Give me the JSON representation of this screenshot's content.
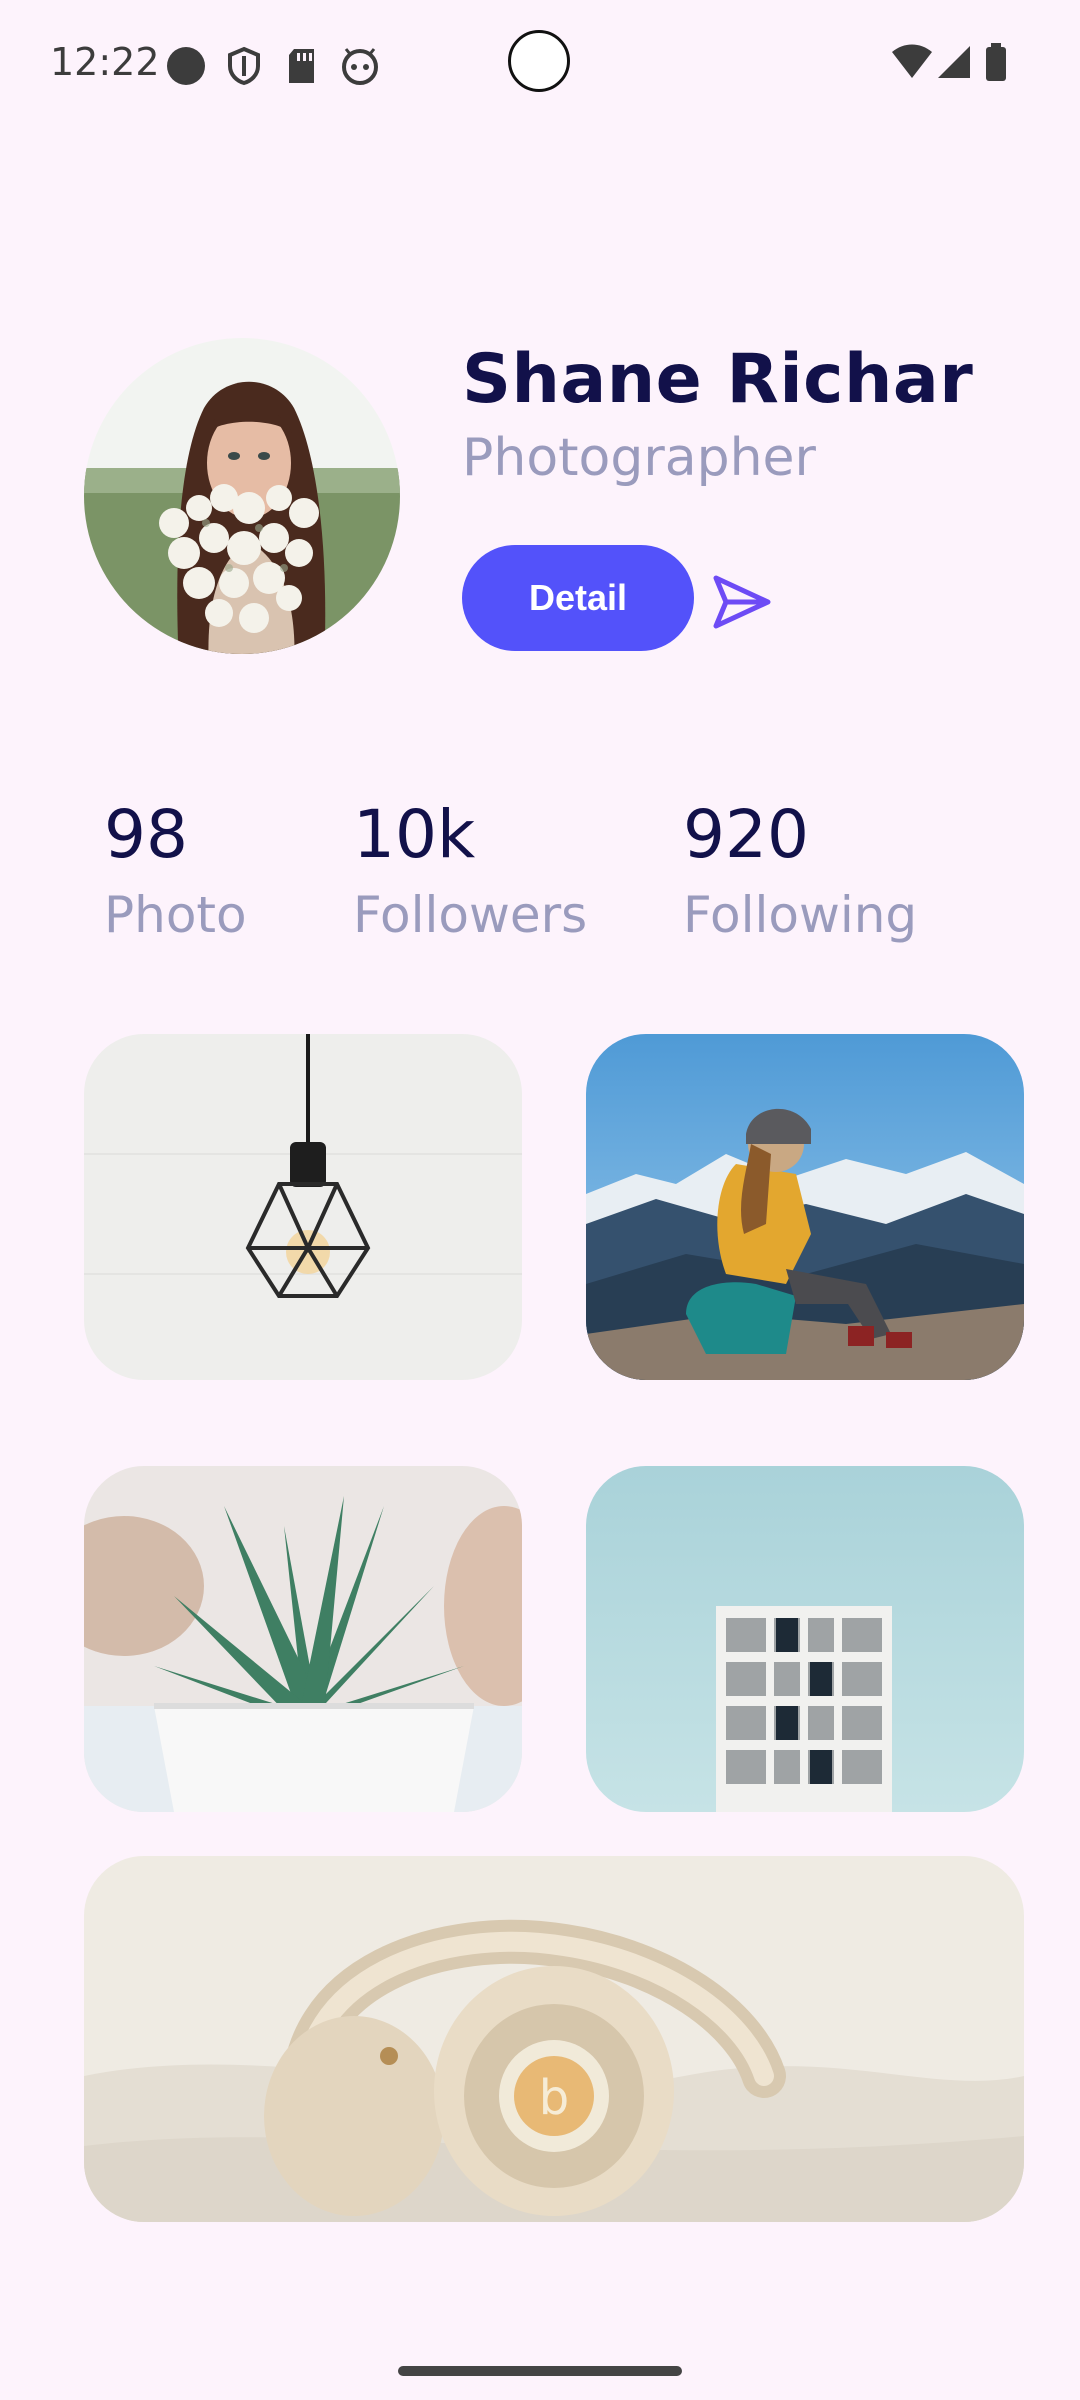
{
  "status_bar": {
    "time": "12:22"
  },
  "profile": {
    "name": "Shane Richar",
    "role": "Photographer",
    "detail_label": "Detail"
  },
  "stats": [
    {
      "value": "98",
      "label": "Photo"
    },
    {
      "value": "10k",
      "label": "Followers"
    },
    {
      "value": "920",
      "label": "Following"
    }
  ],
  "colors": {
    "background": "#fdf3fc",
    "accent": "#5352fa",
    "title": "#12114a",
    "muted": "#9a9bbd"
  },
  "gallery": [
    "pendant-lamp-photo",
    "mountain-hiker-photo",
    "succulent-plant-photo",
    "building-window-photo",
    "headphones-photo"
  ]
}
